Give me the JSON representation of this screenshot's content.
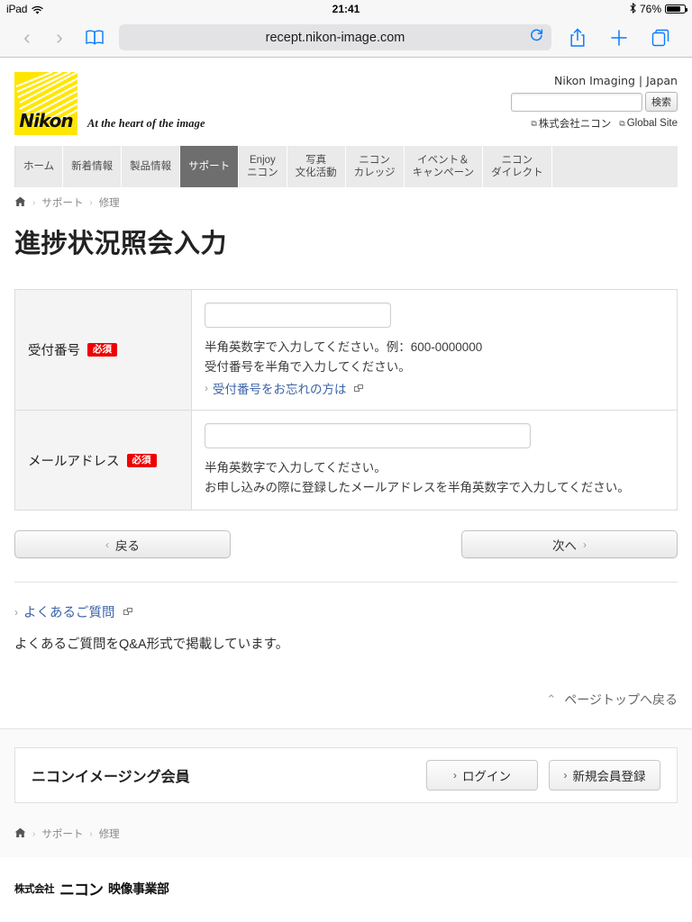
{
  "status_bar": {
    "device": "iPad",
    "wifi_icon": "wifi-icon",
    "time": "21:41",
    "bluetooth_icon": "bluetooth-icon",
    "battery_percent": "76%",
    "battery_icon": "battery-icon"
  },
  "browser": {
    "back_icon": "chevron-left-icon",
    "forward_icon": "chevron-right-icon",
    "bookmarks_icon": "book-icon",
    "url": "recept.nikon-image.com",
    "reload_icon": "reload-icon",
    "share_icon": "share-icon",
    "new_tab_icon": "plus-icon",
    "tabs_icon": "tabs-icon"
  },
  "header": {
    "logo_word": "Nikon",
    "tagline": "At the heart of the image",
    "region": "Nikon Imaging | Japan",
    "search_placeholder": "",
    "search_value": "",
    "search_button": "検索",
    "corp_link": "株式会社ニコン",
    "global_link": "Global Site"
  },
  "gnav": {
    "items": [
      {
        "label": "ホーム",
        "current": false
      },
      {
        "label": "新着情報",
        "current": false
      },
      {
        "label": "製品情報",
        "current": false
      },
      {
        "label": "サポート",
        "current": true
      },
      {
        "label": "Enjoy\nニコン",
        "current": false
      },
      {
        "label": "写真\n文化活動",
        "current": false
      },
      {
        "label": "ニコン\nカレッジ",
        "current": false
      },
      {
        "label": "イベント＆\nキャンペーン",
        "current": false
      },
      {
        "label": "ニコン\nダイレクト",
        "current": false
      }
    ]
  },
  "breadcrumb": {
    "home_icon": "home-icon",
    "items": [
      "サポート",
      "修理"
    ]
  },
  "page_title": "進捗状況照会入力",
  "form": {
    "rows": [
      {
        "label": "受付番号",
        "required_badge": "必須",
        "input_value": "",
        "help_line1": "半角英数字で入力してください。例：600-0000000",
        "help_line2": "受付番号を半角で入力してください。",
        "link_text": "受付番号をお忘れの方は"
      },
      {
        "label": "メールアドレス",
        "required_badge": "必須",
        "input_value": "",
        "help_line1": "半角英数字で入力してください。",
        "help_line2": "お申し込みの際に登録したメールアドレスを半角英数字で入力してください。",
        "link_text": ""
      }
    ]
  },
  "actions": {
    "back_label": "戻る",
    "back_icon": "chevron-left-icon",
    "next_label": "次へ",
    "next_icon": "chevron-right-icon"
  },
  "faq": {
    "link_text": "よくあるご質問",
    "description": "よくあるご質問をQ&A形式で掲載しています。"
  },
  "page_top": {
    "label": "ページトップへ戻る",
    "icon": "chevron-up-icon"
  },
  "member": {
    "title": "ニコンイメージング会員",
    "login_label": "ログイン",
    "register_label": "新規会員登録"
  },
  "footer": {
    "breadcrumb_items": [
      "サポート",
      "修理"
    ],
    "corp_prefix": "株式会社",
    "corp_name": "ニコン",
    "corp_division": "映像事業部"
  },
  "colors": {
    "nikon_yellow": "#ffe600",
    "required_red": "#ef0000",
    "link_blue": "#3c63a8",
    "nav_active": "#6e6e6e",
    "ios_blue": "#0a7cff"
  }
}
